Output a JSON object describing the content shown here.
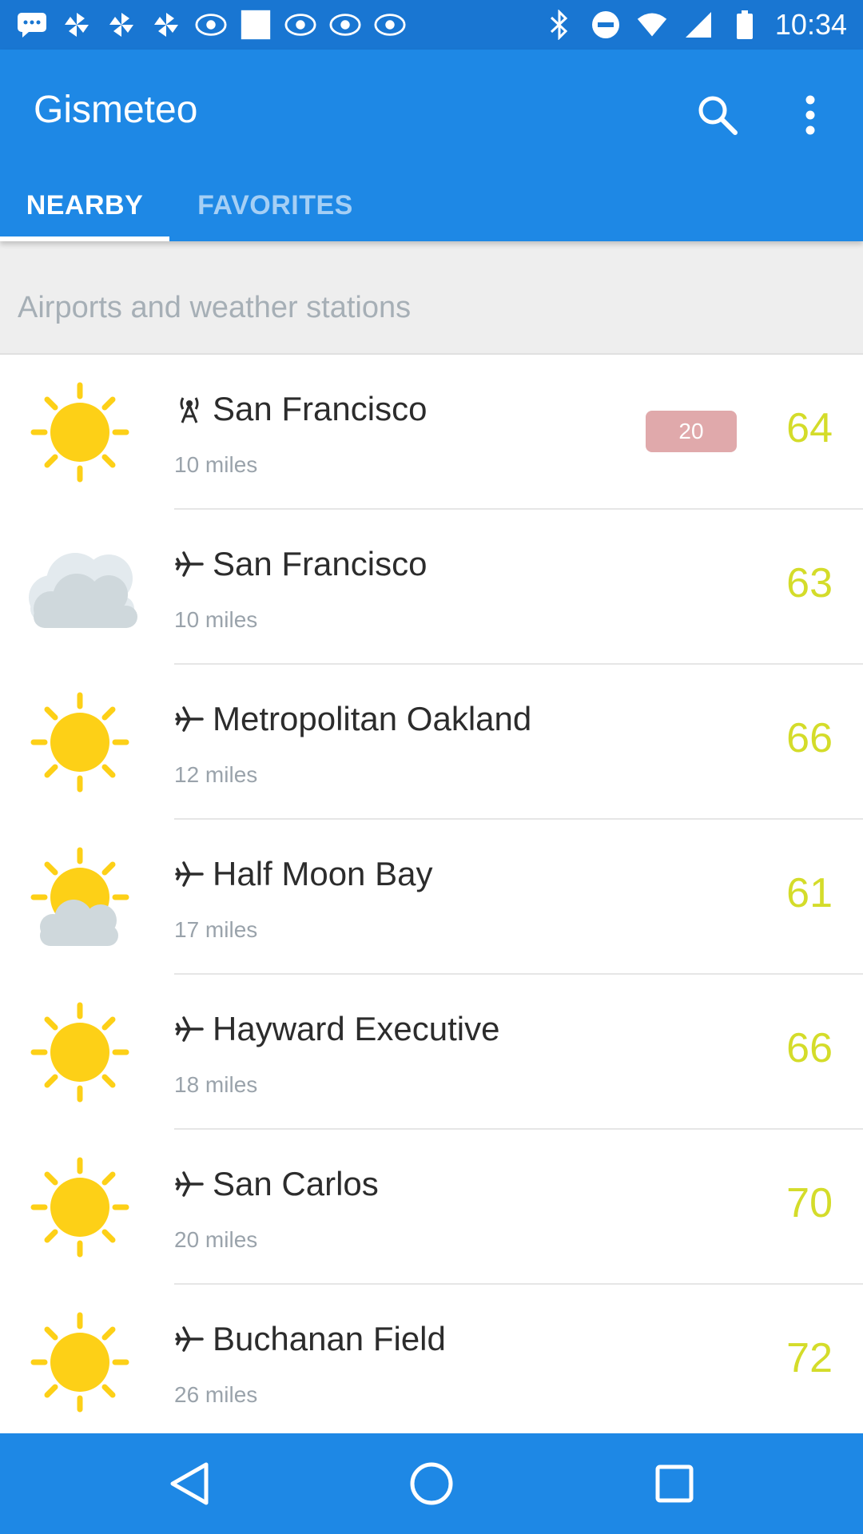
{
  "status_bar": {
    "time": "10:34",
    "icons": [
      "chat-icon",
      "pinwheel-icon",
      "pinwheel-icon",
      "pinwheel-icon",
      "abc13-icon",
      "white-square-icon",
      "abc13-icon",
      "abc13-icon",
      "abc13-icon",
      "bluetooth-icon",
      "do-not-disturb-icon",
      "wifi-icon",
      "signal-icon",
      "battery-icon"
    ]
  },
  "app": {
    "title": "Gismeteo",
    "tabs": [
      {
        "label": "NEARBY",
        "selected": true
      },
      {
        "label": "FAVORITES",
        "selected": false
      }
    ],
    "actions": [
      "search-icon",
      "more-vert-icon"
    ]
  },
  "section": {
    "title": "Airports and weather stations"
  },
  "stations": [
    {
      "name": "San Francisco",
      "type": "station-antenna-icon",
      "distance": "10 miles",
      "temp": "64",
      "badge": "20",
      "weather": "sunny-icon"
    },
    {
      "name": "San Francisco",
      "type": "airplane-icon",
      "distance": "10 miles",
      "temp": "63",
      "weather": "cloudy-icon"
    },
    {
      "name": "Metropolitan Oakland",
      "type": "airplane-icon",
      "distance": "12 miles",
      "temp": "66",
      "weather": "sunny-icon"
    },
    {
      "name": "Half Moon Bay",
      "type": "airplane-icon",
      "distance": "17 miles",
      "temp": "61",
      "weather": "partly-cloudy-icon"
    },
    {
      "name": "Hayward Executive",
      "type": "airplane-icon",
      "distance": "18 miles",
      "temp": "66",
      "weather": "sunny-icon"
    },
    {
      "name": "San Carlos",
      "type": "airplane-icon",
      "distance": "20 miles",
      "temp": "70",
      "weather": "sunny-icon"
    },
    {
      "name": "Buchanan Field",
      "type": "airplane-icon",
      "distance": "26 miles",
      "temp": "72",
      "weather": "sunny-icon"
    }
  ],
  "colors": {
    "status_bar": "#1976d2",
    "app_bar": "#1e88e5",
    "temperature": "#d4dc2a",
    "badge": "#e0a9ab",
    "sun": "#fdd017",
    "cloud": "#cfd8dc"
  },
  "nav_bar": [
    "back-icon",
    "home-icon",
    "recents-icon"
  ]
}
